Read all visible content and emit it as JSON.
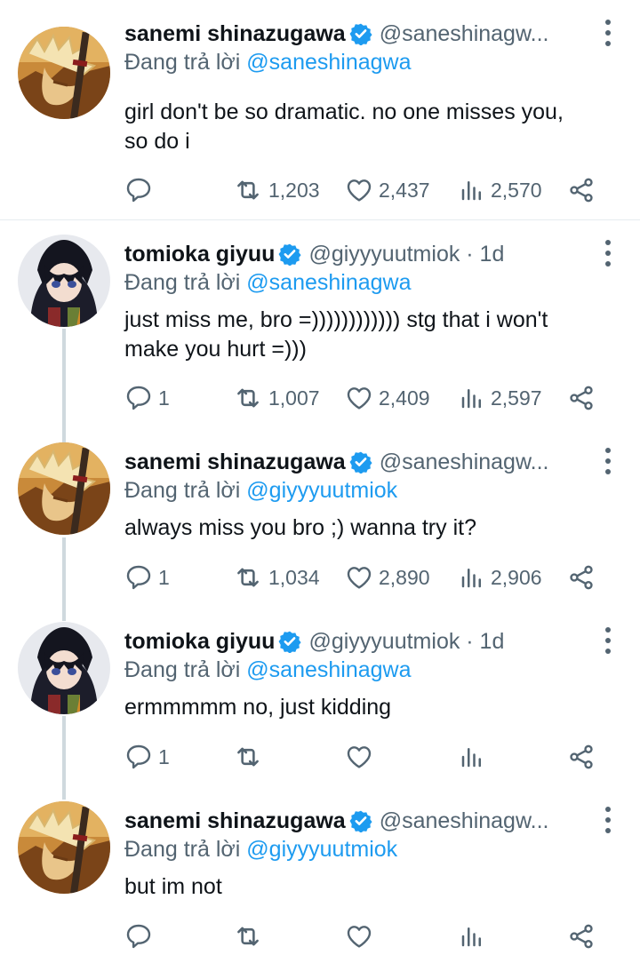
{
  "colors": {
    "accent": "#1d9bf0",
    "muted": "#536471",
    "text": "#0f1419",
    "thread_line": "#cfd9de"
  },
  "icons": {
    "reply": "reply-icon",
    "retweet": "retweet-icon",
    "like": "heart-icon",
    "views": "views-icon",
    "share": "share-icon",
    "more": "more-icon",
    "verified": "verified-badge-icon"
  },
  "tweets": [
    {
      "name": "sanemi shinazugawa",
      "handle": "@saneshinagw...",
      "reply_prefix": "Đang trả lời",
      "reply_to": "@saneshinagwa",
      "text_lines": [
        "girl don't be so dramatic. no one misses you,",
        "so do i"
      ],
      "replies": "",
      "retweets": "1,203",
      "likes": "2,437",
      "views": "2,570"
    },
    {
      "name": "tomioka giyuu",
      "handle": "@giyyyuutmiok · 1d",
      "reply_prefix": "Đang trả lời",
      "reply_to": "@saneshinagwa",
      "text_lines": [
        "just miss me, bro =)))))))))))) stg that i won't",
        "make you hurt =)))"
      ],
      "replies": "1",
      "retweets": "1,007",
      "likes": "2,409",
      "views": "2,597"
    },
    {
      "name": "sanemi shinazugawa",
      "handle": "@saneshinagw...",
      "reply_prefix": "Đang trả lời",
      "reply_to": "@giyyyuutmiok",
      "text_lines": [
        "always miss you bro ;) wanna try it?"
      ],
      "replies": "1",
      "retweets": "1,034",
      "likes": "2,890",
      "views": "2,906"
    },
    {
      "name": "tomioka giyuu",
      "handle": "@giyyyuutmiok · 1d",
      "reply_prefix": "Đang trả lời",
      "reply_to": "@saneshinagwa",
      "text_lines": [
        "ermmmmm no, just kidding"
      ],
      "replies": "1",
      "retweets": "",
      "likes": "",
      "views": ""
    },
    {
      "name": "sanemi shinazugawa",
      "handle": "@saneshinagw...",
      "reply_prefix": "Đang trả lời",
      "reply_to": "@giyyyuutmiok",
      "text_lines": [
        "but im not"
      ],
      "replies": "",
      "retweets": "",
      "likes": "",
      "views": ""
    }
  ]
}
